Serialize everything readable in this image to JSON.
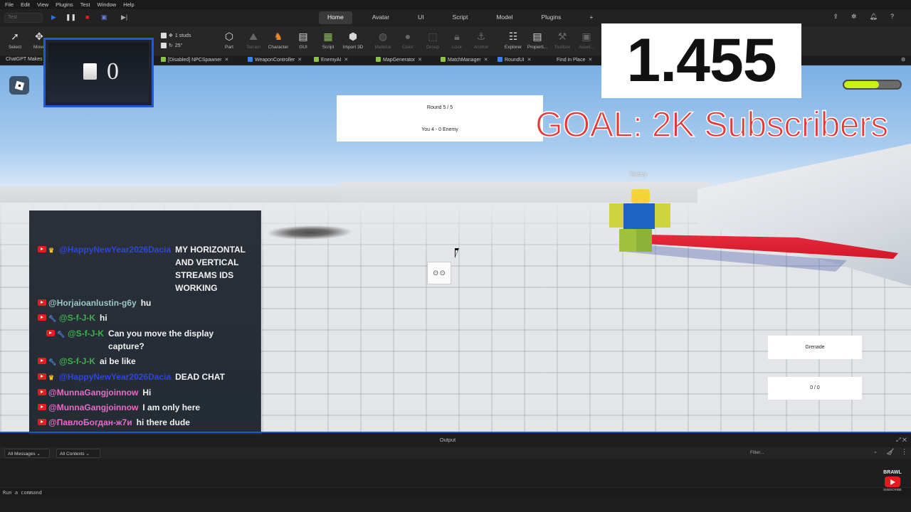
{
  "menu": [
    "File",
    "Edit",
    "View",
    "Plugins",
    "Test",
    "Window",
    "Help"
  ],
  "place_select": "Test",
  "main_tabs": [
    "Home",
    "Avatar",
    "UI",
    "Script",
    "Model",
    "Plugins"
  ],
  "add_tab": "+",
  "tools": [
    {
      "label": "Select",
      "icon": "cursor-icon"
    },
    {
      "label": "Move",
      "icon": "move-icon"
    },
    {
      "label": "Part",
      "icon": "part-icon"
    },
    {
      "label": "Terrain",
      "icon": "terrain-icon"
    },
    {
      "label": "Character",
      "icon": "character-icon"
    },
    {
      "label": "GUI",
      "icon": "gui-icon"
    },
    {
      "label": "Script",
      "icon": "script-icon"
    },
    {
      "label": "Import 3D",
      "icon": "import-icon"
    },
    {
      "label": "Material",
      "icon": "material-icon"
    },
    {
      "label": "Color",
      "icon": "color-icon"
    },
    {
      "label": "Group",
      "icon": "group-icon"
    },
    {
      "label": "Lock",
      "icon": "lock-icon"
    },
    {
      "label": "Anchor",
      "icon": "anchor-icon"
    },
    {
      "label": "Explorer",
      "icon": "explorer-icon"
    },
    {
      "label": "Properti...",
      "icon": "properties-icon"
    },
    {
      "label": "Toolbox",
      "icon": "toolbox-icon"
    },
    {
      "label": "Asset...",
      "icon": "asset-icon"
    }
  ],
  "snap": {
    "studs": "1 studs",
    "angle": "25°"
  },
  "doc_tabs": [
    {
      "label": "ChatGPT Makes"
    },
    {
      "label": "[Disabled] NPCSpawner"
    },
    {
      "label": "WeaponController"
    },
    {
      "label": "EnemyAI"
    },
    {
      "label": "MapGenerator"
    },
    {
      "label": "MatchManager"
    },
    {
      "label": "RoundUI"
    },
    {
      "label": "Find in Place"
    }
  ],
  "viewport": {
    "round": "Round 5 / 5",
    "score": "You 4 - 0 Enemy",
    "enemy_label": "Enemy",
    "grenade": "Grenade",
    "ammo": "0 / 0",
    "health_fraction": 0.62
  },
  "overlay": {
    "counter_value": "0",
    "big_number": "1.455",
    "goal": "GOAL: 2K Subscribers"
  },
  "chat": [
    {
      "user": "@HappyNewYear2026Dacia",
      "color": "blue",
      "badge": "crown",
      "text": "MY HORIZONTAL AND VERTICAL STREAMS IDS WORKING"
    },
    {
      "user": "@Horjaioanlustin-g6y",
      "color": "teal",
      "badge": "",
      "text": "hu"
    },
    {
      "user": "@S-f-J-K",
      "color": "green",
      "badge": "wrench",
      "text": "hi"
    },
    {
      "user": "@S-f-J-K",
      "color": "green",
      "badge": "wrench",
      "text": "Can you move the display capture?"
    },
    {
      "user": "@S-f-J-K",
      "color": "green",
      "badge": "wrench",
      "text": "ai be like"
    },
    {
      "user": "@HappyNewYear2026Dacia",
      "color": "blue",
      "badge": "crown",
      "text": "DEAD CHAT"
    },
    {
      "user": "@MunnaGangjoinnow",
      "color": "pink",
      "badge": "",
      "text": "Hi"
    },
    {
      "user": "@MunnaGangjoinnow",
      "color": "pink",
      "badge": "",
      "text": "I am only here"
    },
    {
      "user": "@ПавлоБогдан-ж7и",
      "color": "pink",
      "badge": "",
      "text": "hi there dude"
    }
  ],
  "output": {
    "title": "Output",
    "messages_filter": "All Messages",
    "contexts_filter": "All Contexts",
    "filter_placeholder": "Filter...",
    "command_placeholder": "Run a command"
  },
  "subscribe": {
    "brand": "BRAWL",
    "label": "SUBSCRIBE"
  }
}
